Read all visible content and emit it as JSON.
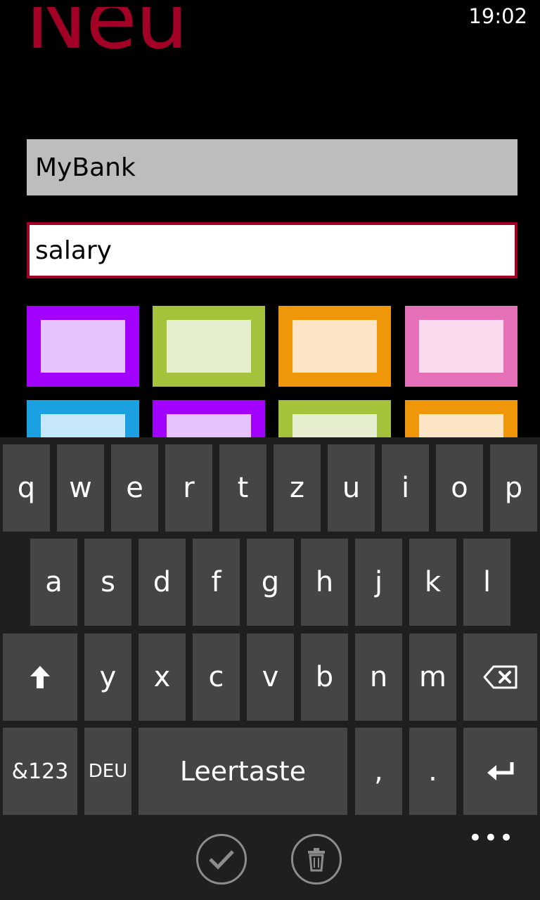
{
  "status": {
    "time": "19:02"
  },
  "page": {
    "title": "Neu"
  },
  "form": {
    "name_value": "MyBank",
    "category_value": "salary"
  },
  "colors": {
    "row1": [
      {
        "border": "#a200ff",
        "fill": "#e6c3ff"
      },
      {
        "border": "#a4c23a",
        "fill": "#e6eed0"
      },
      {
        "border": "#f09609",
        "fill": "#fbe5c4"
      },
      {
        "border": "#e671b8",
        "fill": "#f9daee"
      }
    ],
    "row2": [
      {
        "border": "#1ba1e2",
        "fill": "#c6e7f8"
      },
      {
        "border": "#a200ff",
        "fill": "#e6c3ff"
      },
      {
        "border": "#a4c23a",
        "fill": "#e6eed0"
      },
      {
        "border": "#f09609",
        "fill": "#fbe5c4"
      }
    ]
  },
  "keyboard": {
    "row1": [
      "q",
      "w",
      "e",
      "r",
      "t",
      "z",
      "u",
      "i",
      "o",
      "p"
    ],
    "row2": [
      "a",
      "s",
      "d",
      "f",
      "g",
      "h",
      "j",
      "k",
      "l"
    ],
    "row3": [
      "y",
      "x",
      "c",
      "v",
      "b",
      "n",
      "m"
    ],
    "symbols_label": "&123",
    "language_label": "DEU",
    "space_label": "Leertaste",
    "comma": ",",
    "period": "."
  },
  "appbar": {
    "more": "•••"
  },
  "accent": "#a20025"
}
